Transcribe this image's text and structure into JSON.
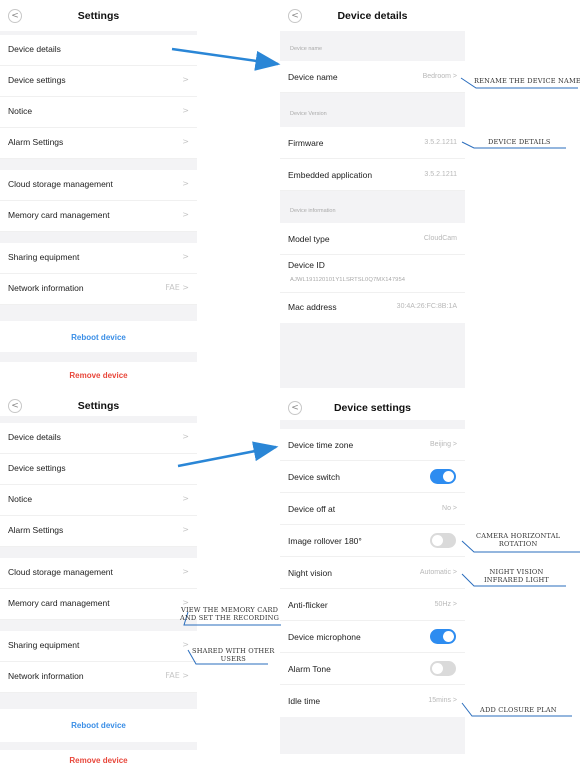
{
  "panel1": {
    "title": "Settings",
    "items": [
      {
        "label": "Device details"
      },
      {
        "label": "Device settings",
        "chevron": ">"
      },
      {
        "label": "Notice",
        "chevron": ">"
      },
      {
        "label": "Alarm Settings",
        "chevron": ">"
      },
      {
        "label": "Cloud storage management",
        "chevron": ">"
      },
      {
        "label": "Memory card management",
        "chevron": ">"
      },
      {
        "label": "Sharing equipment",
        "chevron": ">"
      },
      {
        "label": "Network information",
        "chevron": "FAE >"
      }
    ],
    "reboot": "Reboot device",
    "remove": "Remove device"
  },
  "panel2": {
    "title": "Device details",
    "sections": {
      "name": "Device name",
      "version": "Device Version",
      "info": "Device information"
    },
    "device_name_label": "Device name",
    "device_name_value": "Bedroom >",
    "firmware_label": "Firmware",
    "firmware_value": "3.5.2.1211",
    "embedded_label": "Embedded application",
    "embedded_value": "3.5.2.1211",
    "model_label": "Model type",
    "model_value": "CloudCam",
    "device_id_label": "Device ID",
    "device_id_value": "AJWL191120101Y1LSRTSL0Q7MX147954",
    "mac_label": "Mac address",
    "mac_value": "30:4A:26:FC:8B:1A"
  },
  "panel3": {
    "title": "Settings",
    "items": [
      {
        "label": "Device details",
        "chevron": ">"
      },
      {
        "label": "Device settings"
      },
      {
        "label": "Notice",
        "chevron": ">"
      },
      {
        "label": "Alarm Settings",
        "chevron": ">"
      },
      {
        "label": "Cloud storage management",
        "chevron": ">"
      },
      {
        "label": "Memory card management",
        "chevron": ">"
      },
      {
        "label": "Sharing equipment",
        "chevron": ">"
      },
      {
        "label": "Network information",
        "chevron": "FAE >"
      }
    ],
    "reboot": "Reboot device",
    "remove": "Remove device"
  },
  "panel4": {
    "title": "Device settings",
    "rows": [
      {
        "label": "Device time zone",
        "value": "Beijing >"
      },
      {
        "label": "Device switch",
        "toggle": "on"
      },
      {
        "label": "Device off at",
        "value": "No >"
      },
      {
        "label": "Image rollover 180°",
        "toggle": "off"
      },
      {
        "label": "Night vision",
        "value": "Automatic >"
      },
      {
        "label": "Anti-flicker",
        "value": "50Hz >"
      },
      {
        "label": "Device microphone",
        "toggle": "on"
      },
      {
        "label": "Alarm Tone",
        "toggle": "off"
      },
      {
        "label": "Idle time",
        "value": "15mins >"
      }
    ]
  },
  "annotations": {
    "rename": "RENAME THE DEVICE NAME",
    "details": "DEVICE DETAILS",
    "rotation": "CAMERA HORIZONTAL\nROTATION",
    "infrared": "NIGHT VISION\nINFRARED LIGHT",
    "memory": "VIEW THE MEMORY CARD\nAND SET THE RECORDING",
    "shared": "SHARED WITH OTHER\nUSERS",
    "closure": "ADD CLOSURE PLAN"
  },
  "colors": {
    "accent": "#2d8cf0",
    "danger": "#e8473b",
    "link": "#3a8ee6",
    "arrow": "#2a86d6"
  }
}
